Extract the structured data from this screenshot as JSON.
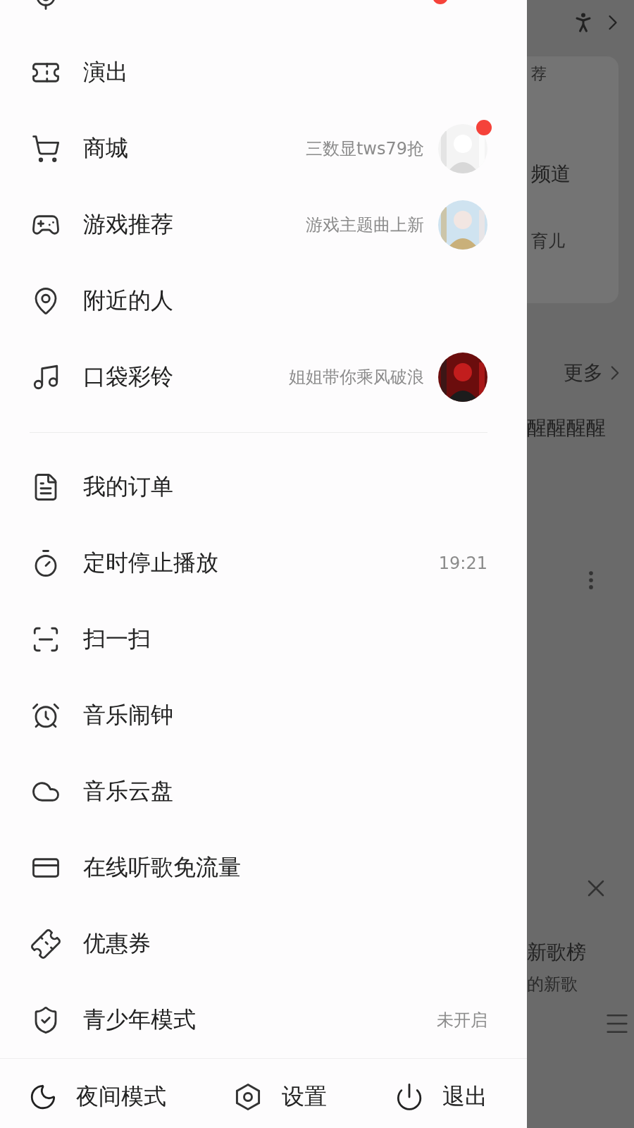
{
  "drawer": {
    "groups": [
      {
        "items": [
          {
            "badge": true
          },
          {
            "label": "演出"
          },
          {
            "label": "商城",
            "detail": "三数显tws79抢",
            "badge": true
          },
          {
            "label": "游戏推荐",
            "detail": "游戏主题曲上新",
            "badge": false
          },
          {
            "label": "附近的人"
          },
          {
            "label": "口袋彩铃",
            "detail": "姐姐带你乘风破浪",
            "badge": false
          }
        ]
      },
      {
        "items": [
          {
            "label": "我的订单"
          },
          {
            "label": "定时停止播放",
            "detail": "19:21"
          },
          {
            "label": "扫一扫"
          },
          {
            "label": "音乐闹钟"
          },
          {
            "label": "音乐云盘"
          },
          {
            "label": "在线听歌免流量"
          },
          {
            "label": "优惠券"
          },
          {
            "label": "青少年模式",
            "detail": "未开启"
          }
        ]
      }
    ],
    "footer": [
      {
        "label": "夜间模式"
      },
      {
        "label": "设置"
      },
      {
        "label": "退出"
      }
    ]
  },
  "background": {
    "card_title": "荐",
    "channel": "频道",
    "channel_sub": "育儿",
    "more": "更多",
    "song": "醒醒醒醒",
    "chart_title": "新歌榜",
    "chart_sub": "的新歌"
  }
}
